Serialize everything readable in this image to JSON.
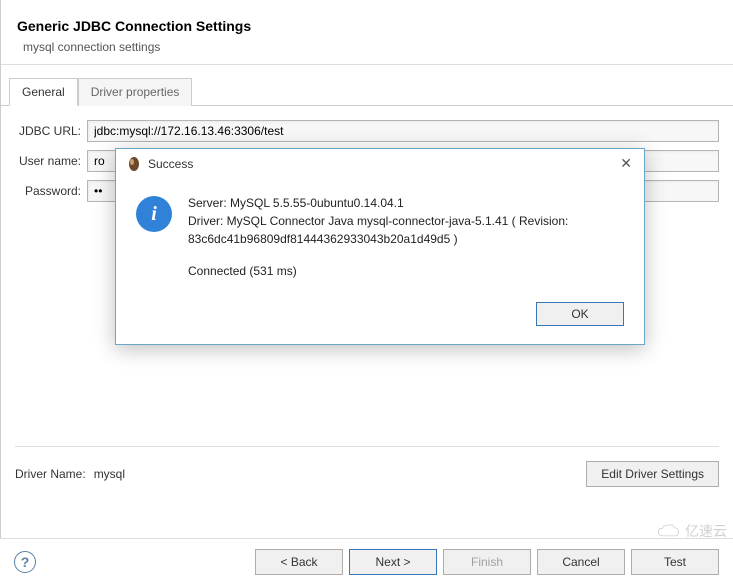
{
  "header": {
    "title": "Generic JDBC Connection Settings",
    "subtitle": "mysql connection settings"
  },
  "tabs": {
    "general": "General",
    "driver_props": "Driver properties"
  },
  "form": {
    "jdbc_url_label": "JDBC URL:",
    "jdbc_url_value": "jdbc:mysql://172.16.13.46:3306/test",
    "username_label": "User name:",
    "username_value": "ro",
    "password_label": "Password:",
    "password_value": "••"
  },
  "driver": {
    "name_label": "Driver Name:",
    "name_value": "mysql",
    "edit_button": "Edit Driver Settings"
  },
  "footer": {
    "back": "< Back",
    "next": "Next >",
    "finish": "Finish",
    "cancel": "Cancel",
    "test": "Test"
  },
  "dialog": {
    "title": "Success",
    "line1": "Server: MySQL 5.5.55-0ubuntu0.14.04.1",
    "line2": "Driver: MySQL Connector Java mysql-connector-java-5.1.41 ( Revision:",
    "line3": "83c6dc41b96809df81444362933043b20a1d49d5 )",
    "line4": "Connected (531 ms)",
    "ok": "OK"
  },
  "watermark": "亿速云"
}
